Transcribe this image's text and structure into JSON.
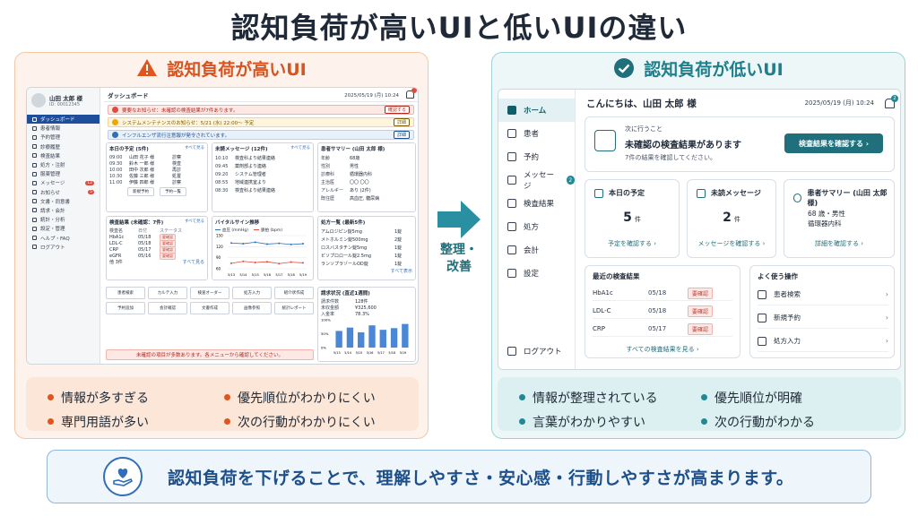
{
  "title": "認知負荷が高いUIと低いUIの違い",
  "colors": {
    "bad_accent": "#d9531e",
    "good_accent": "#1f7f8c",
    "banner": "#1d4f8a"
  },
  "left_panel": {
    "heading": "認知負荷が高いUI",
    "icon": "warning-icon",
    "screen": {
      "user_name": "山田 太郎 様",
      "user_id": "ID: 00012345",
      "nav": [
        {
          "label": "ダッシュボード",
          "count": ""
        },
        {
          "label": "患者情報",
          "count": ""
        },
        {
          "label": "予約管理",
          "count": ""
        },
        {
          "label": "診療履歴",
          "count": ""
        },
        {
          "label": "検査結果",
          "count": ""
        },
        {
          "label": "処方・注射",
          "count": ""
        },
        {
          "label": "服薬管理",
          "count": ""
        },
        {
          "label": "メッセージ",
          "count": "12"
        },
        {
          "label": "お知らせ",
          "count": "5"
        },
        {
          "label": "文書・同意書",
          "count": ""
        },
        {
          "label": "請求・会計",
          "count": ""
        },
        {
          "label": "統計・分析",
          "count": ""
        },
        {
          "label": "設定・管理",
          "count": ""
        },
        {
          "label": "ヘルプ・FAQ",
          "count": ""
        },
        {
          "label": "ログアウト",
          "count": ""
        }
      ],
      "page_title": "ダッシュボード",
      "datetime": "2025/05/19 (月) 10:24",
      "alerts": [
        {
          "text": "要要なお知らせ：未確認の検査結果が7件あります。",
          "button": "確認する"
        },
        {
          "text": "システムメンテナンスのお知らせ：5/21 (水) 22:00〜 予定",
          "button": "詳細"
        },
        {
          "text": "インフルエンザ流行注意報が発令されています。",
          "button": "詳細"
        }
      ],
      "schedule": {
        "title": "本日の予定 (5件)",
        "more": "すべて見る",
        "rows": [
          [
            "09:00",
            "山田 花子 様",
            "診察"
          ],
          [
            "09:30",
            "鈴木 一郎 様",
            "検査"
          ],
          [
            "10:00",
            "田中 次郎 様",
            "再診"
          ],
          [
            "10:30",
            "佐藤 三郎 様",
            "処置"
          ],
          [
            "11:00",
            "伊藤 四郎 様",
            "診察"
          ]
        ],
        "buttons": [
          "新規予約",
          "予約一覧"
        ]
      },
      "messages": {
        "title": "未読メッセージ (12件)",
        "more": "すべて見る",
        "rows": [
          [
            "10:10",
            "検査科より結果連絡"
          ],
          [
            "09:45",
            "薬剤部より連絡"
          ],
          [
            "09:20",
            "システム管理者"
          ],
          [
            "08:55",
            "地域連携室より"
          ],
          [
            "08:30",
            "検査科より結果連絡"
          ]
        ]
      },
      "summary": {
        "title": "患者サマリー (山田 太郎 様)",
        "rows": [
          [
            "年齢",
            "68歳"
          ],
          [
            "性別",
            "男性"
          ],
          [
            "診療科",
            "循環器内科"
          ],
          [
            "主治医",
            "〇〇 〇〇"
          ],
          [
            "アレルギー",
            "あり (2件)"
          ],
          [
            "既往歴",
            "高血圧, 糖尿病"
          ]
        ]
      },
      "labs": {
        "title": "検査結果 (未確認：7件)",
        "more": "すべて見る",
        "headers": [
          "検査名",
          "日付",
          "ステータス"
        ],
        "rows": [
          [
            "HbA1c",
            "05/18",
            "要確認"
          ],
          [
            "LDL-C",
            "05/18",
            "要確認"
          ],
          [
            "CRP",
            "05/17",
            "要確認"
          ],
          [
            "eGFR",
            "05/16",
            "要確認"
          ]
        ],
        "footer": "他 3件",
        "footer_more": "すべて見る"
      },
      "vitals": {
        "title": "バイタルサイン推移",
        "legend": [
          "血圧 (mmHg)",
          "脈拍 (bpm)"
        ],
        "x": [
          "5/13",
          "5/14",
          "5/15",
          "5/16",
          "5/17",
          "5/18",
          "5/19"
        ],
        "bp": [
          130,
          128,
          132,
          127,
          129,
          126,
          128
        ],
        "pulse": [
          75,
          80,
          77,
          79,
          74,
          78,
          76
        ],
        "ticks": [
          "150",
          "120",
          "90",
          "60"
        ]
      },
      "rx": {
        "title": "処方一覧 (最新5件)",
        "rows": [
          [
            "アムロジピン錠5mg",
            "1錠"
          ],
          [
            "メトホルミン錠500mg",
            "2錠"
          ],
          [
            "ロスバスタチン錠5mg",
            "1錠"
          ],
          [
            "ビソプロロール錠2.5mg",
            "1錠"
          ],
          [
            "ランソプラゾールOD錠",
            "1錠"
          ]
        ],
        "more": "すべて表示"
      },
      "actions": [
        "患者検索",
        "カルテ入力",
        "検査オーダー",
        "処方入力",
        "紹介状作成",
        "予約追加",
        "会計確認",
        "文書作成",
        "画像参照",
        "統計レポート"
      ],
      "billing": {
        "title": "請求状況 (直近1週間)",
        "rows": [
          [
            "請求件数",
            "128件"
          ],
          [
            "未収金額",
            "¥325,600"
          ],
          [
            "入金率",
            "78.3%"
          ]
        ],
        "ticks": [
          "100%",
          "50%",
          "0%"
        ],
        "x": [
          "5/13",
          "5/14",
          "5/15",
          "5/16",
          "5/17",
          "5/18",
          "5/19"
        ],
        "values": [
          60,
          72,
          55,
          80,
          64,
          70,
          85
        ]
      },
      "warning": "未確認の項目が多数あります。各メニューから確認してください。"
    },
    "notes": [
      "情報が多すぎる",
      "優先順位がわかりにくい",
      "専門用語が多い",
      "次の行動がわかりにくい"
    ]
  },
  "arrow_label": [
    "整理・",
    "改善"
  ],
  "right_panel": {
    "heading": "認知負荷が低いUI",
    "icon": "check-circle-icon",
    "screen": {
      "nav": [
        {
          "label": "ホーム",
          "count": ""
        },
        {
          "label": "患者",
          "count": ""
        },
        {
          "label": "予約",
          "count": ""
        },
        {
          "label": "メッセージ",
          "count": "2"
        },
        {
          "label": "検査結果",
          "count": ""
        },
        {
          "label": "処方",
          "count": ""
        },
        {
          "label": "会計",
          "count": ""
        },
        {
          "label": "設定",
          "count": ""
        }
      ],
      "logout": "ログアウト",
      "greeting": "こんにちは、山田 太郎 様",
      "datetime": "2025/05/19 (月) 10:24",
      "bell_count": "2",
      "todo": {
        "kicker": "次に行うこと",
        "title": "未確認の検査結果があります",
        "sub": "7件の結果を確認してください。",
        "button": "検査結果を確認する ›"
      },
      "schedule": {
        "title": "本日の予定",
        "value": "5",
        "unit": "件",
        "link": "予定を確認する ›"
      },
      "messages": {
        "title": "未読メッセージ",
        "value": "2",
        "unit": "件",
        "link": "メッセージを確認する ›"
      },
      "summary": {
        "title": "患者サマリー (山田 太郎 様)",
        "line1": "68 歳・男性",
        "line2": "循環器内科",
        "link": "詳細を確認する ›"
      },
      "recent": {
        "title": "最近の検査結果",
        "rows": [
          [
            "HbA1c",
            "05/18",
            "要確認"
          ],
          [
            "LDL-C",
            "05/18",
            "要確認"
          ],
          [
            "CRP",
            "05/17",
            "要確認"
          ]
        ],
        "link": "すべての検査結果を見る ›"
      },
      "quick": {
        "title": "よく使う操作",
        "rows": [
          {
            "label": "患者検索",
            "icon": "search-icon"
          },
          {
            "label": "新規予約",
            "icon": "calendar-icon"
          },
          {
            "label": "処方入力",
            "icon": "pill-icon"
          }
        ]
      }
    },
    "notes": [
      "情報が整理されている",
      "優先順位が明確",
      "言葉がわかりやすい",
      "次の行動がわかる"
    ]
  },
  "banner": "認知負荷を下げることで、理解しやすさ・安心感・行動しやすさが高まります。"
}
